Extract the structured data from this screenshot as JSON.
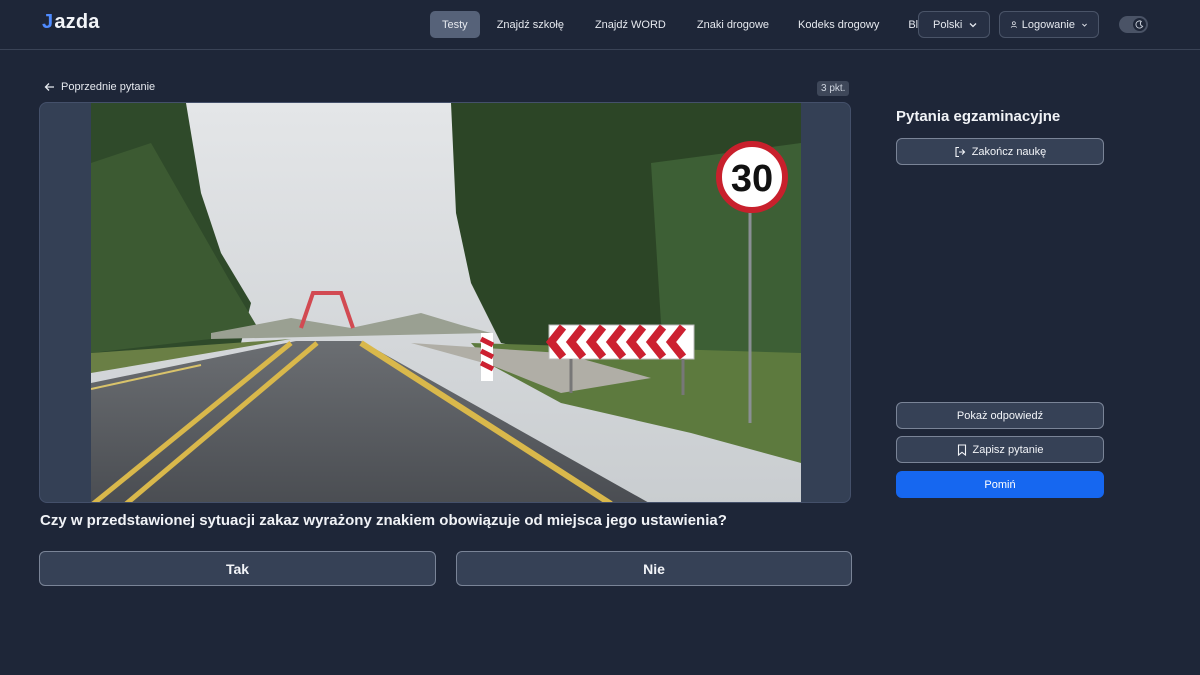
{
  "header": {
    "logo": "azda",
    "logo_prefix": "J",
    "nav": [
      "Testy",
      "Znajdź szkołę",
      "Znajdź WORD",
      "Znaki drogowe",
      "Kodeks drogowy",
      "Blog"
    ],
    "active_nav": "Testy",
    "language": "Polski",
    "login": "Logowanie",
    "theme_icon": "moon-icon"
  },
  "main": {
    "back_label": "Poprzednie pytanie",
    "points": "3 pkt.",
    "question": "Czy w przedstawionej sytuacji zakaz wyrażony znakiem obowiązuje od miejsca jego ustawienia?",
    "answers": {
      "yes": "Tak",
      "no": "Nie"
    },
    "sign_value": "30"
  },
  "side": {
    "title": "Pytania egzaminacyjne",
    "end_label": "Zakończ naukę",
    "show_answer_label": "Pokaż odpowiedź",
    "save_label": "Zapisz pytanie",
    "skip_label": "Pomiń"
  },
  "colors": {
    "background": "#1e2638",
    "accent": "#1667f0",
    "logo_accent": "#4f8bff"
  }
}
